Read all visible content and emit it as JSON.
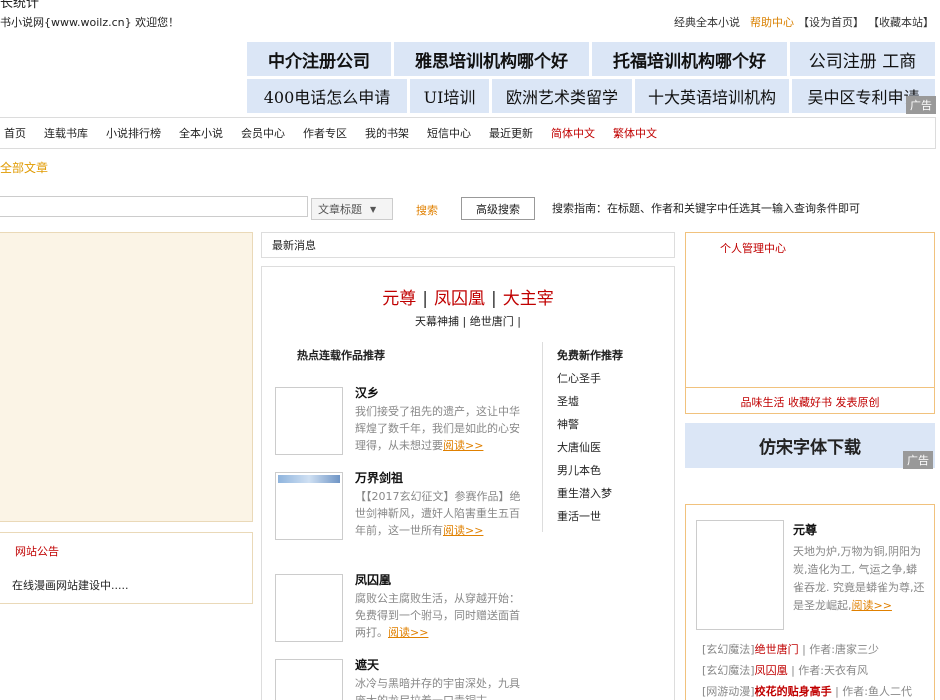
{
  "header": {
    "cut_title": "长统计",
    "welcome": "书小说网{www.woilz.cn} 欢迎您！",
    "links": [
      "经典全本小说",
      "帮助中心",
      "【设为首页】",
      "【收藏本站】"
    ]
  },
  "ads": {
    "row1": [
      "中介注册公司",
      "雅思培训机构哪个好",
      "托福培训机构哪个好",
      "公司注册 工商"
    ],
    "row2": [
      "400电话怎么申请",
      "UI培训",
      "欧洲艺术类留学",
      "十大英语培训机构",
      "吴中区专利申请"
    ],
    "tag": "广告"
  },
  "nav": [
    "首页",
    "连载书库",
    "小说排行榜",
    "全本小说",
    "会员中心",
    "作者专区",
    "我的书架",
    "短信中心",
    "最近更新",
    "简体中文",
    "繁体中文"
  ],
  "breadcrumb": "全部文章",
  "search": {
    "field": "文章标题",
    "button": "搜索",
    "advanced": "高级搜索",
    "guide": "搜索指南：在标题、作者和关键字中任选其一输入查询条件即可"
  },
  "notice": {
    "title": "网站公告",
    "text": "在线漫画网站建设中....."
  },
  "news": {
    "title": "最新消息"
  },
  "feature": {
    "titles": [
      "元尊",
      "凤囚凰",
      "大主宰"
    ],
    "sep": "|",
    "sub": "天幕神捕 | 绝世唐门 |"
  },
  "hot": {
    "title": "热点连载作品推荐",
    "more": "阅读>>",
    "books": [
      {
        "name": "汉乡",
        "desc": "我们接受了祖先的遗产，这让中华辉煌了数千年，我们是如此的心安理得，从未想过要"
      },
      {
        "name": "万界剑祖",
        "desc": "【【2017玄幻征文】参赛作品】绝世剑神靳风，遭奸人陷害重生五百年前，这一世所有"
      },
      {
        "name": "凤囚凰",
        "desc": "腐败公主腐败生活，从穿越开始：免费得到一个驸马，同时赠送面首两打。"
      },
      {
        "name": "遮天",
        "desc": "冰冷与黑暗并存的宇宙深处，九具庞大的龙尸拉着一口青铜古"
      }
    ]
  },
  "new_rec": {
    "title": "免费新作推荐",
    "items": [
      "仁心圣手",
      "圣墟",
      "神警",
      "大唐仙医",
      "男儿本色",
      "重生潜入梦",
      "重活一世"
    ]
  },
  "manager": {
    "title": "个人管理中心",
    "footer": "品味生活 收藏好书 发表原创"
  },
  "font_ad": {
    "label": "仿宋字体下载",
    "tag": "广告"
  },
  "side_book": {
    "name": "元尊",
    "desc": "天地为炉,万物为铜,阴阳为炭,造化为工, 气运之争,蟒雀吞龙. 究竟是蟒雀为尊,还是圣龙崛起,",
    "more": "阅读>>",
    "list": [
      {
        "cat": "[玄幻魔法]",
        "title": "绝世唐门",
        "author": "作者:唐家三少"
      },
      {
        "cat": "[玄幻魔法]",
        "title": "凤囚凰",
        "author": "作者:天衣有风"
      },
      {
        "cat": "[网游动漫]",
        "title": "校花的贴身高手",
        "author": "作者:鱼人二代"
      }
    ]
  }
}
